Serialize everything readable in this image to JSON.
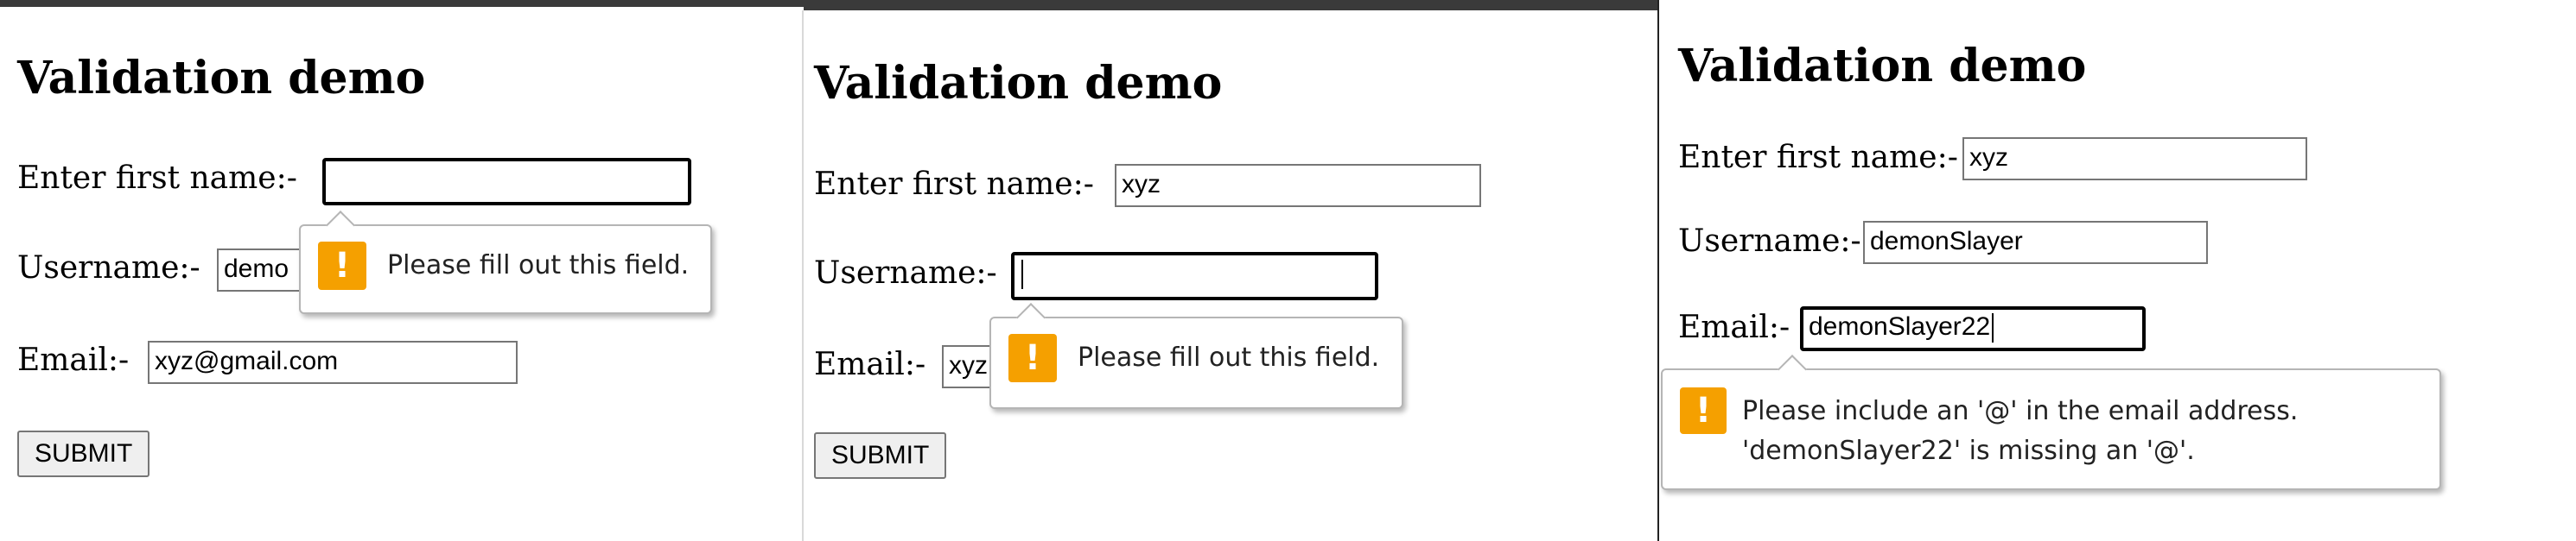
{
  "icons": {
    "tooltip_icon": "warning-icon",
    "tooltip_icon_color": "#f5a000"
  },
  "panels": [
    {
      "title": "Validation demo",
      "first_name_label": "Enter first name:-",
      "first_name_value": "",
      "username_label": "Username:-",
      "username_value": "demo",
      "email_label": "Email:-",
      "email_value": "xyz@gmail.com",
      "submit_label": "SUBMIT",
      "tooltip_icon_glyph": "!",
      "tooltip_message": "Please fill out this field."
    },
    {
      "title": "Validation demo",
      "first_name_label": "Enter first name:-",
      "first_name_value": "xyz",
      "username_label": "Username:-",
      "username_value": "",
      "email_label": "Email:-",
      "email_value": "xyz",
      "submit_label": "SUBMIT",
      "tooltip_icon_glyph": "!",
      "tooltip_message": "Please fill out this field."
    },
    {
      "title": "Validation demo",
      "first_name_label": "Enter first name:-",
      "first_name_value": "xyz",
      "username_label": "Username:-",
      "username_value": "demonSlayer",
      "email_label": "Email:-",
      "email_value": "demonSlayer22",
      "tooltip_icon_glyph": "!",
      "tooltip_message_line1": "Please include an '@' in the email address.",
      "tooltip_message_line2": "'demonSlayer22' is missing an '@'."
    }
  ]
}
